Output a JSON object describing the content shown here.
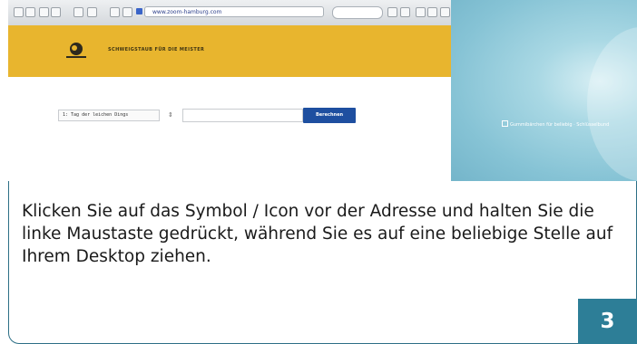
{
  "browser": {
    "url": "www.zoom-hamburg.com"
  },
  "site": {
    "title": "SCHWEIGSTAUB FÜR DIE MEISTER"
  },
  "form": {
    "select_value": "1: Tag der leichen Dings",
    "select_arrow": "⇕",
    "button_label": "Berechnen"
  },
  "desktop": {
    "link_label": "Gummibärchen für beliebig · Schlüsselbund"
  },
  "instruction": {
    "text": "Klicken Sie auf das Symbol / Icon vor der Adresse und halten Sie die linke Maustaste gedrückt, während Sie es auf eine beliebige Stelle auf Ihrem Desktop ziehen."
  },
  "step": {
    "number": "3"
  },
  "colors": {
    "accent": "#2d7e97",
    "header": "#e8b52e",
    "button": "#1e4fa0"
  }
}
